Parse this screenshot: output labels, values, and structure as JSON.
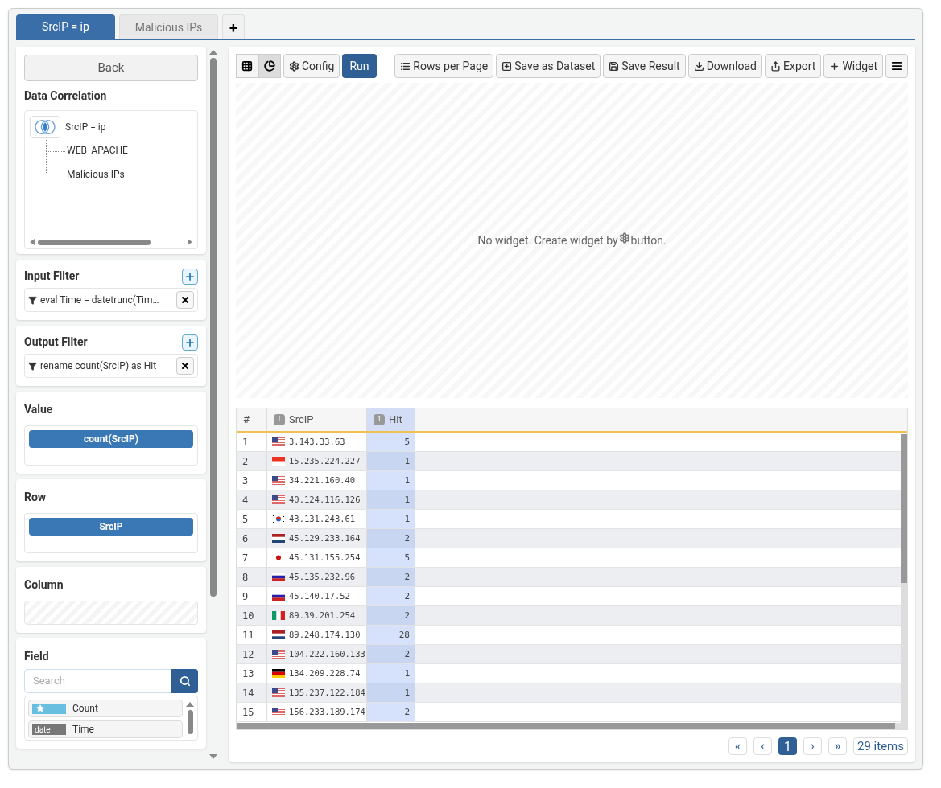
{
  "tabs": [
    {
      "label": "SrcIP = ip",
      "selected": true
    },
    {
      "label": "Malicious IPs",
      "selected": false
    }
  ],
  "add_tab": "+",
  "sidebar": {
    "back": "Back",
    "correlation": {
      "title": "Data Correlation",
      "root": "SrcIP = ip",
      "children": [
        {
          "label": "WEB_APACHE"
        },
        {
          "label": "Malicious IPs"
        }
      ]
    },
    "input_filter": {
      "title": "Input Filter",
      "filters": [
        "eval Time = datetrunc(Tim…"
      ]
    },
    "output_filter": {
      "title": "Output Filter",
      "filters": [
        "rename count(SrcIP) as Hit"
      ]
    },
    "value": {
      "title": "Value",
      "chips": [
        "count(SrcIP)"
      ]
    },
    "row": {
      "title": "Row",
      "chips": [
        "SrcIP"
      ]
    },
    "column": {
      "title": "Column"
    },
    "field": {
      "title": "Field",
      "search": {
        "placeholder": "Search"
      },
      "items": [
        {
          "kind": "measure",
          "label": "Count"
        },
        {
          "kind": "date",
          "badge": "date",
          "label": "Time"
        }
      ]
    }
  },
  "toolbar": {
    "view_modes": [
      {
        "kind": "grid",
        "selected": false
      },
      {
        "kind": "pie",
        "selected": true
      }
    ],
    "config": "Config",
    "run": "Run",
    "actions": [
      {
        "kind": "list",
        "label": "Rows per Page"
      },
      {
        "kind": "plus-square",
        "label": "Save as Dataset"
      },
      {
        "kind": "save",
        "label": "Save Result"
      },
      {
        "kind": "download",
        "label": "Download"
      },
      {
        "kind": "share",
        "label": "Export"
      },
      {
        "kind": "plus",
        "label": "Widget"
      }
    ]
  },
  "widget_area": {
    "message_before": "No widget. Create widget by",
    "message_after": "button."
  },
  "table": {
    "columns": [
      {
        "label": "#"
      },
      {
        "label": "SrcIP",
        "type_badge": "I"
      },
      {
        "label": "Hit",
        "type_badge": "1"
      }
    ],
    "rows": [
      {
        "index": "1",
        "kind": "us",
        "ip": "3.143.33.63",
        "hit": "5"
      },
      {
        "index": "2",
        "kind": "sg",
        "ip": "15.235.224.227",
        "hit": "1"
      },
      {
        "index": "3",
        "kind": "us",
        "ip": "34.221.160.40",
        "hit": "1"
      },
      {
        "index": "4",
        "kind": "us",
        "ip": "40.124.116.126",
        "hit": "1"
      },
      {
        "index": "5",
        "kind": "kr",
        "ip": "43.131.243.61",
        "hit": "1"
      },
      {
        "index": "6",
        "kind": "nl",
        "ip": "45.129.233.164",
        "hit": "2"
      },
      {
        "index": "7",
        "kind": "jp",
        "ip": "45.131.155.254",
        "hit": "5"
      },
      {
        "index": "8",
        "kind": "ru",
        "ip": "45.135.232.96",
        "hit": "2"
      },
      {
        "index": "9",
        "kind": "ru",
        "ip": "45.140.17.52",
        "hit": "2"
      },
      {
        "index": "10",
        "kind": "it",
        "ip": "89.39.201.254",
        "hit": "2"
      },
      {
        "index": "11",
        "kind": "nl",
        "ip": "89.248.174.130",
        "hit": "28"
      },
      {
        "index": "12",
        "kind": "us",
        "ip": "104.222.160.133",
        "hit": "2"
      },
      {
        "index": "13",
        "kind": "de",
        "ip": "134.209.228.74",
        "hit": "1"
      },
      {
        "index": "14",
        "kind": "us",
        "ip": "135.237.122.184",
        "hit": "1"
      },
      {
        "index": "15",
        "kind": "us",
        "ip": "156.233.189.174",
        "hit": "2"
      }
    ]
  },
  "pagination": {
    "first": "«",
    "prev": "‹",
    "pages": [
      {
        "label": "1",
        "selected": true
      }
    ],
    "next": "›",
    "last": "»",
    "total": "29 items"
  }
}
